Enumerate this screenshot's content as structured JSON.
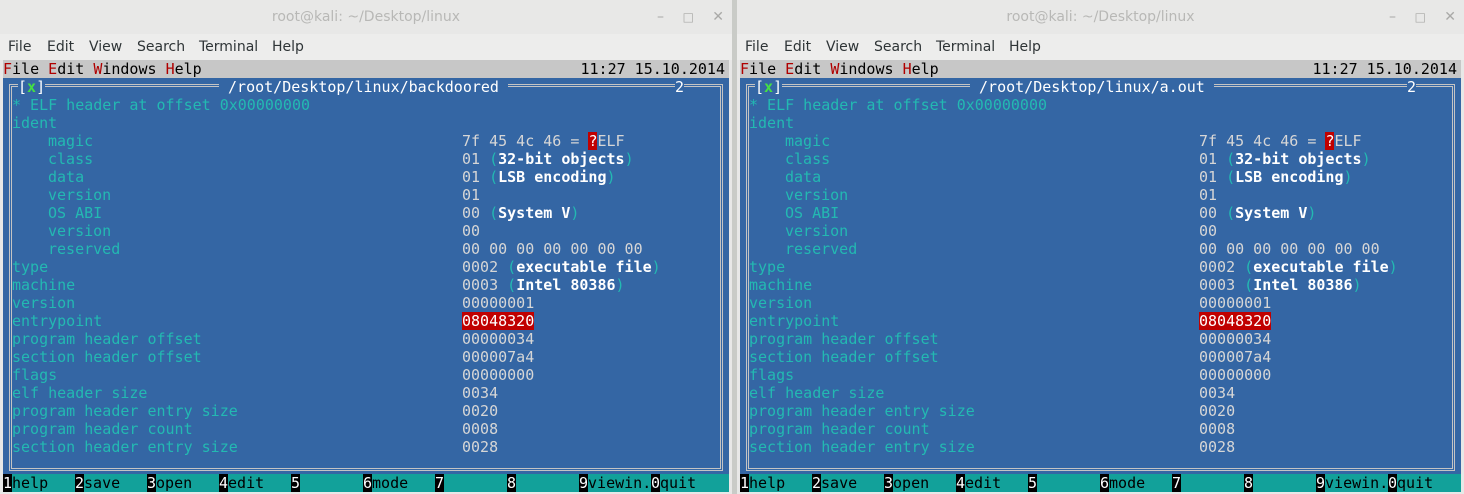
{
  "windows": [
    {
      "title": "root@kali: ~/Desktop/linux",
      "menu": [
        "File",
        "Edit",
        "View",
        "Search",
        "Terminal",
        "Help"
      ],
      "topbar": {
        "menu": [
          "File",
          "Edit",
          "Windows",
          "Help"
        ],
        "clock": "11:27 15.10.2014"
      },
      "panel": {
        "close_mark": "x",
        "path": " /root/Desktop/linux/backdoored ",
        "num": "2"
      },
      "header_comment": "* ELF header at offset 0x00000000",
      "fields": [
        {
          "label": "ident",
          "value": "",
          "desc": ""
        },
        {
          "label": "magic",
          "value": "7f 45 4c 46 = ",
          "glyph": "?",
          "desc": "ELF",
          "indent": true
        },
        {
          "label": "class",
          "value": "01",
          "desc": "32-bit objects",
          "indent": true
        },
        {
          "label": "data",
          "value": "01",
          "desc": "LSB encoding",
          "indent": true
        },
        {
          "label": "version",
          "value": "01",
          "desc": "",
          "indent": true
        },
        {
          "label": "OS ABI",
          "value": "00",
          "desc": "System V",
          "indent": true
        },
        {
          "label": "version",
          "value": "00",
          "desc": "",
          "indent": true
        },
        {
          "label": "reserved",
          "value": "00 00 00 00 00 00 00",
          "desc": "",
          "indent": true
        },
        {
          "label": "type",
          "value": "0002",
          "desc": "executable file"
        },
        {
          "label": "machine",
          "value": "0003",
          "desc": "Intel 80386"
        },
        {
          "label": "version",
          "value": "00000001",
          "desc": ""
        },
        {
          "label": "entrypoint",
          "value": "08048320",
          "desc": "",
          "highlight": true
        },
        {
          "label": "program header offset",
          "value": "00000034",
          "desc": ""
        },
        {
          "label": "section header offset",
          "value": "000007a4",
          "desc": ""
        },
        {
          "label": "flags",
          "value": "00000000",
          "desc": ""
        },
        {
          "label": "elf header size",
          "value": "0034",
          "desc": ""
        },
        {
          "label": "program header entry size",
          "value": "0020",
          "desc": ""
        },
        {
          "label": "program header count",
          "value": "0008",
          "desc": ""
        },
        {
          "label": "section header entry size",
          "value": "0028",
          "desc": ""
        }
      ],
      "fkeys": [
        {
          "n": "1",
          "label": "help"
        },
        {
          "n": "2",
          "label": "save"
        },
        {
          "n": "3",
          "label": "open"
        },
        {
          "n": "4",
          "label": "edit"
        },
        {
          "n": "5",
          "label": ""
        },
        {
          "n": "6",
          "label": "mode"
        },
        {
          "n": "7",
          "label": ""
        },
        {
          "n": "8",
          "label": ""
        },
        {
          "n": "9",
          "label": "viewin."
        },
        {
          "n": "0",
          "label": "quit"
        }
      ]
    },
    {
      "title": "root@kali: ~/Desktop/linux",
      "menu": [
        "File",
        "Edit",
        "View",
        "Search",
        "Terminal",
        "Help"
      ],
      "topbar": {
        "menu": [
          "File",
          "Edit",
          "Windows",
          "Help"
        ],
        "clock": "11:27 15.10.2014"
      },
      "panel": {
        "close_mark": "x",
        "path": " /root/Desktop/linux/a.out ",
        "num": "2"
      },
      "header_comment": "* ELF header at offset 0x00000000",
      "fields": [
        {
          "label": "ident",
          "value": "",
          "desc": ""
        },
        {
          "label": "magic",
          "value": "7f 45 4c 46 = ",
          "glyph": "?",
          "desc": "ELF",
          "indent": true
        },
        {
          "label": "class",
          "value": "01",
          "desc": "32-bit objects",
          "indent": true
        },
        {
          "label": "data",
          "value": "01",
          "desc": "LSB encoding",
          "indent": true
        },
        {
          "label": "version",
          "value": "01",
          "desc": "",
          "indent": true
        },
        {
          "label": "OS ABI",
          "value": "00",
          "desc": "System V",
          "indent": true
        },
        {
          "label": "version",
          "value": "00",
          "desc": "",
          "indent": true
        },
        {
          "label": "reserved",
          "value": "00 00 00 00 00 00 00",
          "desc": "",
          "indent": true
        },
        {
          "label": "type",
          "value": "0002",
          "desc": "executable file"
        },
        {
          "label": "machine",
          "value": "0003",
          "desc": "Intel 80386"
        },
        {
          "label": "version",
          "value": "00000001",
          "desc": ""
        },
        {
          "label": "entrypoint",
          "value": "08048320",
          "desc": "",
          "highlight": true
        },
        {
          "label": "program header offset",
          "value": "00000034",
          "desc": ""
        },
        {
          "label": "section header offset",
          "value": "000007a4",
          "desc": ""
        },
        {
          "label": "flags",
          "value": "00000000",
          "desc": ""
        },
        {
          "label": "elf header size",
          "value": "0034",
          "desc": ""
        },
        {
          "label": "program header entry size",
          "value": "0020",
          "desc": ""
        },
        {
          "label": "program header count",
          "value": "0008",
          "desc": ""
        },
        {
          "label": "section header entry size",
          "value": "0028",
          "desc": ""
        }
      ],
      "fkeys": [
        {
          "n": "1",
          "label": "help"
        },
        {
          "n": "2",
          "label": "save"
        },
        {
          "n": "3",
          "label": "open"
        },
        {
          "n": "4",
          "label": "edit"
        },
        {
          "n": "5",
          "label": ""
        },
        {
          "n": "6",
          "label": "mode"
        },
        {
          "n": "7",
          "label": ""
        },
        {
          "n": "8",
          "label": ""
        },
        {
          "n": "9",
          "label": "viewin."
        },
        {
          "n": "0",
          "label": "quit"
        }
      ]
    }
  ],
  "window_controls": {
    "minimize": "–",
    "maximize": "□",
    "close": "✕"
  },
  "colors": {
    "terminal_bg": "#3466a4",
    "key_text": "#23b9b2",
    "highlight": "#c00000",
    "fkey_bar": "#12a19a"
  }
}
